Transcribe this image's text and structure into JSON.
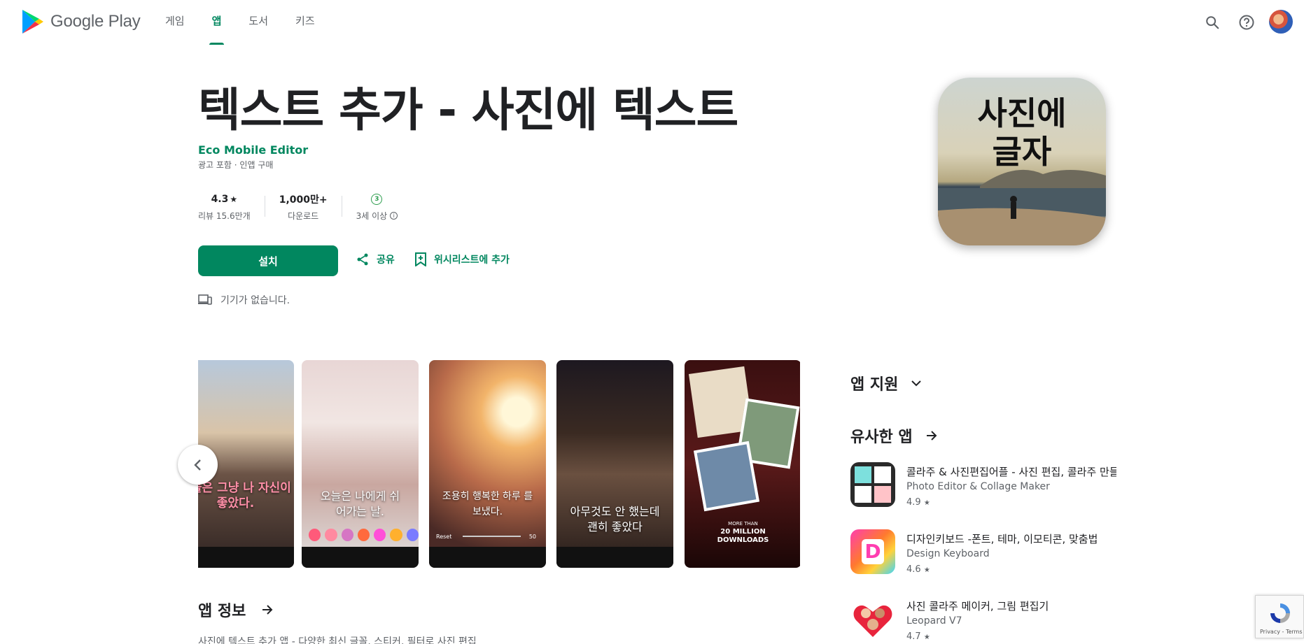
{
  "header": {
    "logo_text": "Google Play",
    "nav": [
      {
        "label": "게임",
        "active": false
      },
      {
        "label": "앱",
        "active": true
      },
      {
        "label": "도서",
        "active": false
      },
      {
        "label": "키즈",
        "active": false
      }
    ],
    "icons": [
      "search-icon",
      "help-icon",
      "avatar"
    ]
  },
  "app": {
    "title": "텍스트 추가 - 사진에 텍스트",
    "developer": "Eco Mobile Editor",
    "sub": "광고 포함 · 인앱 구매",
    "icon_text_line1": "사진에",
    "icon_text_line2": "글자"
  },
  "stats": {
    "rating_value": "4.3",
    "rating_label": "리뷰 15.6만개",
    "downloads_value": "1,000만+",
    "downloads_label": "다운로드",
    "age_badge": "3",
    "age_label": "3세 이상"
  },
  "actions": {
    "install": "설치",
    "share": "공유",
    "wishlist": "위시리스트에 추가",
    "device_notice": "기기가 없습니다."
  },
  "screenshots": [
    {
      "caption": "오늘은 그냥 나 자신이 좋았다."
    },
    {
      "caption": "오늘은 나에게 쉬 어가는 날."
    },
    {
      "caption": "조용히 행복한 하루 를 보냈다.",
      "slider_label": "Reset",
      "slider_value": "50"
    },
    {
      "caption": "아무것도 안 했는데 괜히 좋았다"
    },
    {
      "caption_top": "MORE THAN",
      "caption_main": "20 MILLION DOWNLOADS"
    }
  ],
  "about": {
    "heading": "앱 정보",
    "description": "사진에 텍스트 추가 앱 - 다양한 최신 글꼴, 스티커, 필터로 사진 편집"
  },
  "sidebar": {
    "app_support": "앱 지원",
    "similar_heading": "유사한 앱",
    "similar": [
      {
        "name": "콜라주 & 사진편집어플 - 사진 편집, 콜라주 만들기",
        "developer": "Photo Editor & Collage Maker",
        "rating": "4.9"
      },
      {
        "name": "디자인키보드 -폰트, 테마, 이모티콘, 맞춤법",
        "developer": "Design Keyboard",
        "rating": "4.6"
      },
      {
        "name": "사진 콜라주 메이커, 그림 편집기",
        "developer": "Leopard V7",
        "rating": "4.7"
      }
    ]
  },
  "recaptcha": {
    "text": "Privacy - Terms"
  },
  "colors": {
    "accent": "#01875f",
    "text": "#202124",
    "muted": "#5f6368"
  }
}
